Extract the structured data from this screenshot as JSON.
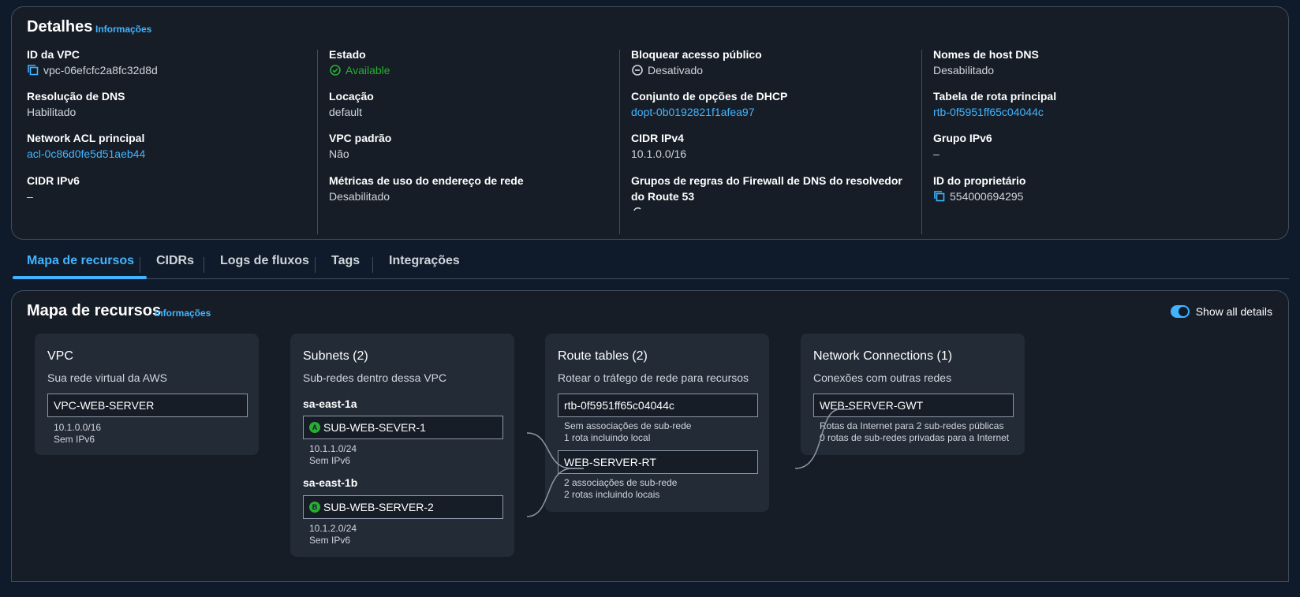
{
  "details": {
    "title": "Detalhes",
    "info_link": "Informações",
    "columns": [
      [
        {
          "label": "ID da VPC",
          "value": "vpc-06efcfc2a8fc32d8d",
          "copy_icon": true
        },
        {
          "label": "Resolução de DNS",
          "value": "Habilitado"
        },
        {
          "label": "Network ACL principal",
          "value": "acl-0c86d0fe5d51aeb44",
          "link": true
        },
        {
          "label": "CIDR IPv6",
          "value": "–"
        }
      ],
      [
        {
          "label": "Estado",
          "value": "Available",
          "status": "success"
        },
        {
          "label": "Locação",
          "value": "default"
        },
        {
          "label": "VPC padrão",
          "value": "Não"
        },
        {
          "label": "Métricas de uso do endereço de rede",
          "value": "Desabilitado"
        }
      ],
      [
        {
          "label": "Bloquear acesso público",
          "value": "Desativado",
          "status": "disabled"
        },
        {
          "label": "Conjunto de opções de DHCP",
          "value": "dopt-0b0192821f1afea97",
          "link": true
        },
        {
          "label": "CIDR IPv4",
          "value": "10.1.0.0/16"
        },
        {
          "label": "Grupos de regras do Firewall de DNS do resolvedor do Route 53",
          "value": "",
          "loading": true
        }
      ],
      [
        {
          "label": "Nomes de host DNS",
          "value": "Desabilitado"
        },
        {
          "label": "Tabela de rota principal",
          "value": "rtb-0f5951ff65c04044c",
          "link": true
        },
        {
          "label": "Grupo IPv6",
          "value": "–"
        },
        {
          "label": "ID do proprietário",
          "value": "554000694295",
          "copy_icon": true
        }
      ]
    ]
  },
  "tabs": [
    "Mapa de recursos",
    "CIDRs",
    "Logs de fluxos",
    "Tags",
    "Integrações"
  ],
  "resource_map": {
    "title": "Mapa de recursos",
    "info_link": "Informações",
    "toggle_label": "Show all details",
    "vpc": {
      "title": "VPC",
      "subtitle": "Sua rede virtual da AWS",
      "node": "VPC-WEB-SERVER",
      "meta": [
        "10.1.0.0/16",
        "Sem IPv6"
      ]
    },
    "subnets": {
      "title": "Subnets (2)",
      "subtitle": "Sub-redes dentro dessa VPC",
      "zones": [
        {
          "name": "sa-east-1a",
          "badge": "A",
          "node": "SUB-WEB-SEVER-1",
          "meta": [
            "10.1.1.0/24",
            "Sem IPv6"
          ]
        },
        {
          "name": "sa-east-1b",
          "badge": "B",
          "node": "SUB-WEB-SERVER-2",
          "meta": [
            "10.1.2.0/24",
            "Sem IPv6"
          ]
        }
      ]
    },
    "route_tables": {
      "title": "Route tables (2)",
      "subtitle": "Rotear o tráfego de rede para recursos",
      "items": [
        {
          "node": "rtb-0f5951ff65c04044c",
          "meta": [
            "Sem associações de sub-rede",
            "1 rota incluindo local"
          ]
        },
        {
          "node": "WEB-SERVER-RT",
          "meta": [
            "2 associações de sub-rede",
            "2 rotas incluindo locais"
          ]
        }
      ]
    },
    "network_connections": {
      "title": "Network Connections (1)",
      "subtitle": "Conexões com outras redes",
      "node": "WEB-SERVER-GWT",
      "meta": [
        "Rotas da Internet para 2 sub-redes públicas",
        "0 rotas de sub-redes privadas para a Internet"
      ]
    }
  },
  "colors": {
    "background": "#0f1b2a",
    "panel": "#161d26",
    "card": "#232b37",
    "accent": "#42b4ff",
    "success": "#29ad32",
    "border": "#414d5c"
  }
}
